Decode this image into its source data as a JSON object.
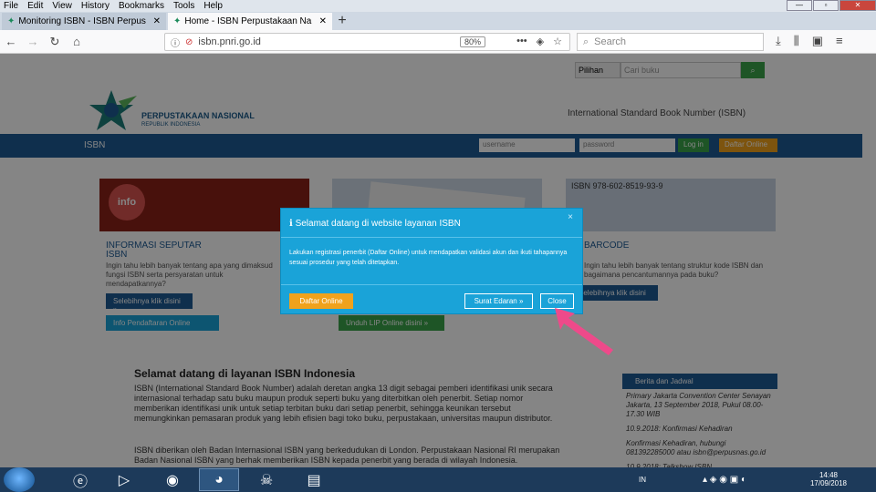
{
  "menubar": {
    "items": [
      "File",
      "Edit",
      "View",
      "History",
      "Bookmarks",
      "Tools",
      "Help"
    ]
  },
  "tabs": [
    {
      "title": "Monitoring ISBN - ISBN Perpus",
      "close": "✕"
    },
    {
      "title": "Home - ISBN Perpustakaan Na",
      "close": "✕"
    }
  ],
  "newtab": "+",
  "url": "isbn.pnri.go.id",
  "zoom": "80%",
  "url_more": "•••",
  "search_placeholder": "Search",
  "site": {
    "pill_select": "Pilihan",
    "pill_input": "Cari buku",
    "logo_title": "PERPUSTAKAAN NASIONAL",
    "logo_sub": "REPUBLIK INDONESIA",
    "header_right": "International Standard Book Number (ISBN)",
    "nav_label": "ISBN",
    "username_ph": "username",
    "password_ph": "password",
    "login": "Log in",
    "daftar_online": "Daftar Online",
    "card1_title": "INFORMASI SEPUTAR",
    "card1_title2": "ISBN",
    "card1_text": "Ingin tahu lebih banyak tentang apa yang dimaksud fungsi ISBN serta persyaratan untuk mendapatkannya?",
    "card1_btn": "Selebihnya klik disini »",
    "card1_btn2": "Info Pendaftaran Online",
    "card2_btn": "Unduh LIP Online disini »",
    "card3_title": "BARCODE",
    "card3_text": "Ingin tahu lebih banyak tentang struktur kode ISBN dan bagaimana pencantumannya pada buku?",
    "card3_btn": "Selebihnya klik disini »",
    "card3_isbn": "ISBN 978-602-8519-93-9",
    "headline": "Selamat datang di layanan ISBN Indonesia",
    "para1": "ISBN (International Standard Book Number) adalah deretan angka 13 digit sebagai pemberi identifikasi unik secara internasional terhadap satu buku maupun produk seperti buku yang diterbitkan oleh penerbit. Setiap nomor memberikan identifikasi unik untuk setiap terbitan buku dari setiap penerbit, sehingga keunikan tersebut memungkinkan pemasaran produk yang lebih efisien bagi toko buku, perpustakaan, universitas maupun distributor.",
    "para2": "ISBN diberikan oleh Badan Internasional ISBN yang berkedudukan di London. Perpustakaan Nasional RI merupakan Badan Nasional ISBN yang berhak memberikan ISBN kepada penerbit yang berada di wilayah Indonesia.",
    "side_head": "Berita dan Jadwal",
    "side_text1": "Primary Jakarta Convention Center Senayan Jakarta, 13 September 2018, Pukul 08.00-17.30 WIB",
    "side_text2": "10.9.2018: Konfirmasi Kehadiran",
    "side_text3": "Konfirmasi Kehadiran, hubungi 081392285000 atau isbn@perpusnas.go.id",
    "side_text4": "10.9.2018: Talkshow ISBN"
  },
  "modal": {
    "title": "Selamat datang di website layanan ISBN",
    "close_x": "×",
    "body": "Lakukan registrasi penerbit (Daftar Online) untuk mendapatkan validasi akun dan ikuti tahapannya sesuai prosedur yang telah ditetapkan.",
    "btn_daftar": "Daftar Online",
    "btn_surat": "Surat Edaran »",
    "btn_close": "Close"
  },
  "taskbar": {
    "lang": "IN",
    "time": "14:48",
    "date": "17/09/2018"
  },
  "colors": {
    "accent": "#1e5b94",
    "modal": "#1aa3d8",
    "arrow": "#ee4a8a",
    "orange": "#f0a21c",
    "green": "#3aa44a"
  }
}
